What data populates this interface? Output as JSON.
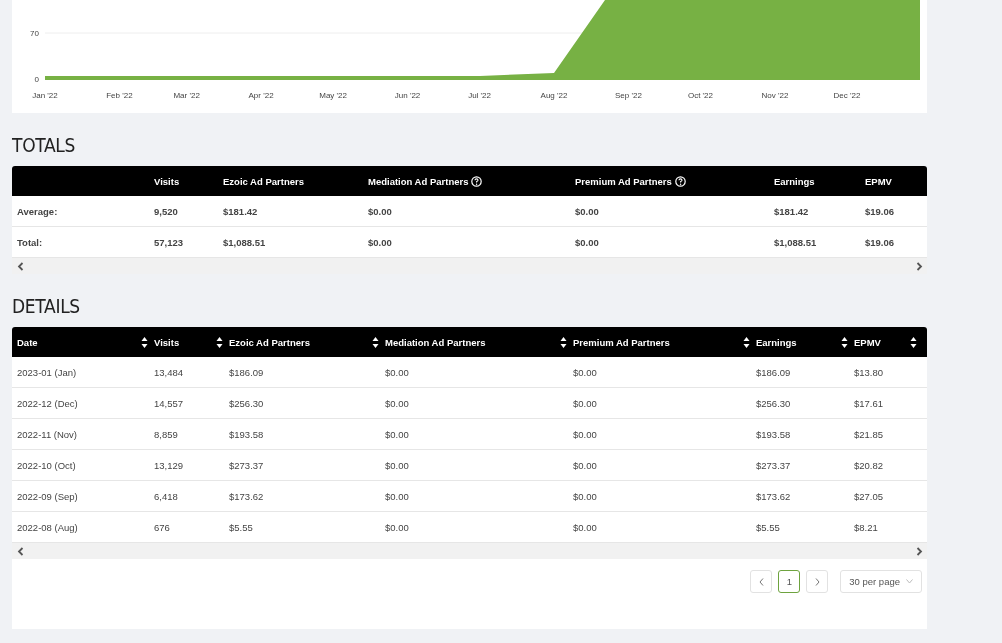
{
  "chart": {
    "y_axis_labels": [
      "70",
      "0"
    ],
    "x_axis_labels": [
      "Jan '22",
      "Feb '22",
      "Mar '22",
      "Apr '22",
      "May '22",
      "Jun '22",
      "Jul '22",
      "Aug '22",
      "Sep '22",
      "Oct '22",
      "Nov '22",
      "Dec '22"
    ]
  },
  "totals": {
    "heading": "TOTALS",
    "columns": [
      {
        "help": false
      },
      {
        "label": "Visits",
        "help": false
      },
      {
        "label": "Ezoic Ad Partners",
        "help": false
      },
      {
        "label": "Mediation Ad Partners",
        "help": true
      },
      {
        "label": "Premium Ad Partners",
        "help": true
      },
      {
        "label": "Earnings",
        "help": false
      },
      {
        "label": "EPMV",
        "help": false
      }
    ],
    "rows": [
      [
        "Average:",
        "9,520",
        "$181.42",
        "$0.00",
        "$0.00",
        "$181.42",
        "$19.06"
      ],
      [
        "Total:",
        "57,123",
        "$1,088.51",
        "$0.00",
        "$0.00",
        "$1,088.51",
        "$19.06"
      ]
    ]
  },
  "details": {
    "heading": "DETAILS",
    "columns": [
      {
        "label": "Date",
        "sortable": true
      },
      {
        "label": "Visits",
        "sortable": true
      },
      {
        "label": "Ezoic Ad Partners",
        "sortable": true
      },
      {
        "label": "Mediation Ad Partners",
        "sortable": true
      },
      {
        "label": "Premium Ad Partners",
        "sortable": true
      },
      {
        "label": "Earnings",
        "sortable": true
      },
      {
        "label": "EPMV",
        "sortable": true
      }
    ],
    "rows": [
      [
        "2023-01 (Jan)",
        "13,484",
        "$186.09",
        "$0.00",
        "$0.00",
        "$186.09",
        "$13.80"
      ],
      [
        "2022-12 (Dec)",
        "14,557",
        "$256.30",
        "$0.00",
        "$0.00",
        "$256.30",
        "$17.61"
      ],
      [
        "2022-11 (Nov)",
        "8,859",
        "$193.58",
        "$0.00",
        "$0.00",
        "$193.58",
        "$21.85"
      ],
      [
        "2022-10 (Oct)",
        "13,129",
        "$273.37",
        "$0.00",
        "$0.00",
        "$273.37",
        "$20.82"
      ],
      [
        "2022-09 (Sep)",
        "6,418",
        "$173.62",
        "$0.00",
        "$0.00",
        "$173.62",
        "$27.05"
      ],
      [
        "2022-08 (Aug)",
        "676",
        "$5.55",
        "$0.00",
        "$0.00",
        "$5.55",
        "$8.21"
      ]
    ]
  },
  "pagination": {
    "pages": [
      {
        "label": "1",
        "selected": true
      }
    ],
    "per_page": "30 per page"
  }
}
